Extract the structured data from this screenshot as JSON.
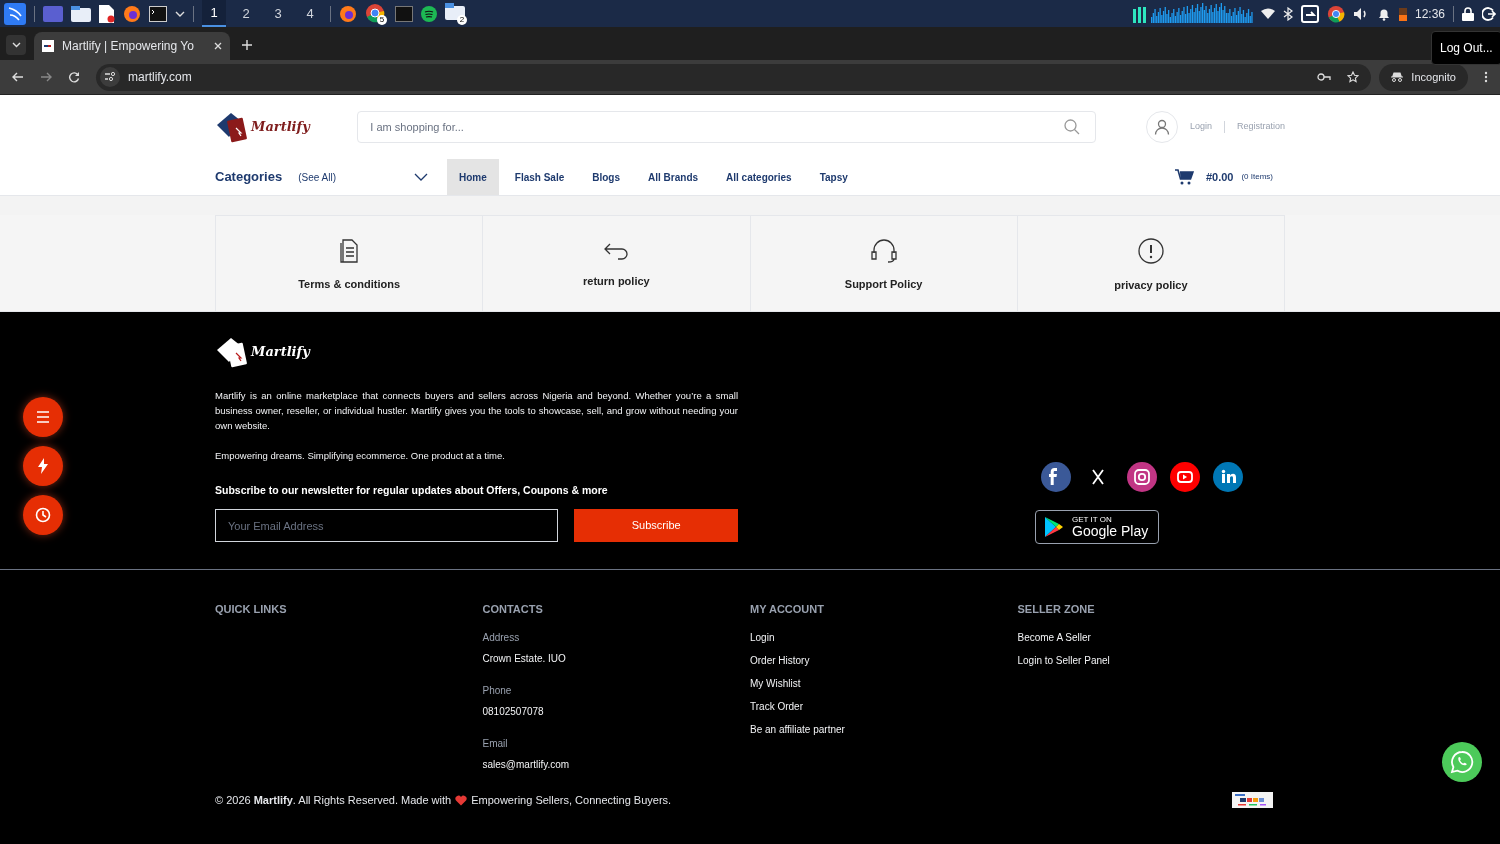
{
  "taskbar": {
    "workspaces": [
      {
        "label": "1",
        "selected": true
      },
      {
        "label": "2",
        "selected": false
      },
      {
        "label": "3",
        "selected": false
      },
      {
        "label": "4",
        "selected": false
      }
    ],
    "browser_badge": "5",
    "files_badge": "2",
    "clock": "12:36",
    "tooltip": "Log Out..."
  },
  "browser": {
    "tab_title": "Martlify | Empowering Yo",
    "url": "martlify.com",
    "profile": "Incognito"
  },
  "header": {
    "logo_text": "Martlify",
    "search_placeholder": "I am shopping for...",
    "login": "Login",
    "registration": "Registration"
  },
  "nav": {
    "categories": "Categories",
    "see_all": "(See All)",
    "links": [
      {
        "label": "Home",
        "selected": true
      },
      {
        "label": "Flash Sale",
        "selected": false
      },
      {
        "label": "Blogs",
        "selected": false
      },
      {
        "label": "All Brands",
        "selected": false
      },
      {
        "label": "All categories",
        "selected": false
      },
      {
        "label": "Tapsy",
        "selected": false
      }
    ],
    "cart_total": "#0.00",
    "cart_items": "(0 Items)"
  },
  "policies": [
    {
      "kind": "document",
      "label": "Terms & conditions"
    },
    {
      "kind": "return",
      "label": "return policy"
    },
    {
      "kind": "headset",
      "label": "Support Policy"
    },
    {
      "kind": "alert",
      "label": "privacy policy"
    }
  ],
  "footer": {
    "logo_text": "Martlify",
    "about": "Martlify is an online marketplace that connects buyers and sellers across Nigeria and beyond. Whether you’re a small business owner, reseller, or individual hustler. Martlify gives you the tools to showcase, sell, and grow without needing your own website.",
    "tagline": "Empowering dreams. Simplifying ecommerce. One product at a time.",
    "newsletter_heading": "Subscribe to our newsletter for regular updates about Offers, Coupons & more",
    "email_placeholder": "Your Email Address",
    "subscribe": "Subscribe",
    "socials": [
      {
        "kind": "facebook",
        "color": "#3b5998"
      },
      {
        "kind": "x",
        "color": "#000000"
      },
      {
        "kind": "instagram",
        "color": "#c13584"
      },
      {
        "kind": "youtube",
        "color": "#ff0000"
      },
      {
        "kind": "linkedin",
        "color": "#0077b5"
      }
    ],
    "play_small": "GET IT ON",
    "play_big": "Google Play",
    "columns": [
      {
        "heading": "QUICK LINKS"
      },
      {
        "heading": "CONTACTS",
        "items": [
          {
            "kind": "label",
            "text": "Address"
          },
          {
            "kind": "value",
            "text": "Crown Estate. IUO"
          },
          {
            "kind": "label",
            "text": "Phone"
          },
          {
            "kind": "value",
            "text": "08102507078"
          },
          {
            "kind": "label",
            "text": "Email"
          },
          {
            "kind": "value",
            "text": "sales@martlify.com"
          }
        ]
      },
      {
        "heading": "MY ACCOUNT",
        "items": [
          {
            "kind": "link",
            "text": "Login"
          },
          {
            "kind": "link",
            "text": "Order History"
          },
          {
            "kind": "link",
            "text": "My Wishlist"
          },
          {
            "kind": "link",
            "text": "Track Order"
          },
          {
            "kind": "link",
            "text": "Be an affiliate partner"
          }
        ]
      },
      {
        "heading": "SELLER ZONE",
        "items": [
          {
            "kind": "link",
            "text": "Become A Seller"
          },
          {
            "kind": "link",
            "text": "Login to Seller Panel"
          }
        ]
      }
    ],
    "copyright_before": "© 2026 **Martlify**. All Rights Reserved. Made with",
    "copyright_after": "Empowering Sellers, Connecting Buyers."
  },
  "floating": [
    {
      "kind": "menu"
    },
    {
      "kind": "bolt"
    },
    {
      "kind": "clock"
    }
  ]
}
